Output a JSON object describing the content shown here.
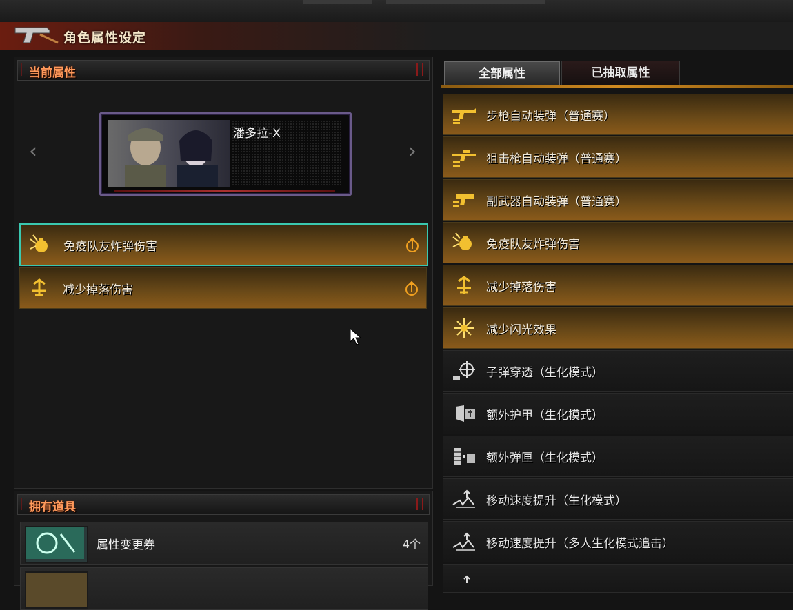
{
  "window": {
    "title": "角色属性设定"
  },
  "left": {
    "header": "当前属性",
    "character": {
      "name": "潘多拉-X"
    },
    "attributes": [
      {
        "label": "免疫队友炸弹伤害",
        "icon": "grenade-icon",
        "selected": true
      },
      {
        "label": "减少掉落伤害",
        "icon": "fall-icon",
        "selected": false
      }
    ]
  },
  "props": {
    "header": "拥有道具",
    "items": [
      {
        "name": "属性变更券",
        "count": "4个",
        "icon": "swap-ticket-icon"
      },
      {
        "name": "",
        "count": "",
        "icon": "extract-ticket-icon"
      }
    ]
  },
  "right": {
    "tabs": [
      {
        "label": "全部属性",
        "active": true
      },
      {
        "label": "已抽取属性",
        "active": false
      }
    ],
    "items": [
      {
        "label": "步枪自动装弹（普通赛）",
        "style": "gold",
        "icon": "rifle-icon"
      },
      {
        "label": "狙击枪自动装弹（普通赛）",
        "style": "gold",
        "icon": "sniper-icon"
      },
      {
        "label": "副武器自动装弹（普通赛）",
        "style": "gold",
        "icon": "pistol-icon"
      },
      {
        "label": "免疫队友炸弹伤害",
        "style": "gold",
        "icon": "grenade-icon"
      },
      {
        "label": "减少掉落伤害",
        "style": "gold",
        "icon": "fall-icon"
      },
      {
        "label": "减少闪光效果",
        "style": "gold",
        "icon": "flash-icon"
      },
      {
        "label": "子弹穿透（生化模式）",
        "style": "dark",
        "icon": "crosshair-icon"
      },
      {
        "label": "额外护甲（生化模式）",
        "style": "dark",
        "icon": "armor-icon"
      },
      {
        "label": "额外弹匣（生化模式）",
        "style": "dark",
        "icon": "magazine-icon"
      },
      {
        "label": "移动速度提升（生化模式）",
        "style": "dark",
        "icon": "speed-icon"
      },
      {
        "label": "移动速度提升（多人生化模式追击）",
        "style": "dark",
        "icon": "speed-icon"
      }
    ]
  },
  "colors": {
    "gold": "#8a5a1a",
    "accent": "#ff9a5c",
    "selected_border": "#3ac8b0"
  }
}
